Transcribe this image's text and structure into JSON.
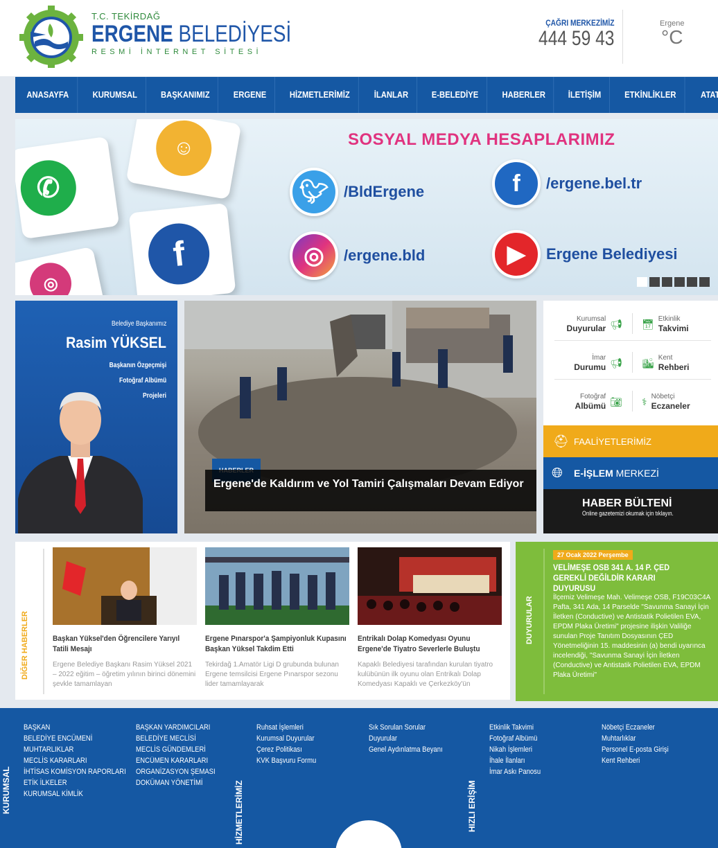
{
  "header": {
    "sub": "T.C. TEKİRDAĞ",
    "main_bold": "ERGENE",
    "main_light": "BELEDİYESİ",
    "tag": "RESMİ İNTERNET SİTESİ",
    "call_label": "ÇAĞRI MERKEZİMİZ",
    "call_number": "444 59 43",
    "weather_city": "Ergene",
    "weather_deg": "°C"
  },
  "nav": [
    "ANASAYFA",
    "KURUMSAL",
    "BAŞKANIMIZ",
    "ERGENE",
    "HİZMETLERİMİZ",
    "İLANLAR",
    "E-BELEDİYE",
    "HABERLER",
    "İLETİŞİM",
    "ETKİNLİKLER",
    "ATATÜRK EVİ"
  ],
  "banner": {
    "title": "SOSYAL MEDYA HESAPLARIMIZ",
    "twitter": "/BldErgene",
    "facebook": "/ergene.bel.tr",
    "instagram": "/ergene.bld",
    "youtube": "Ergene Belediyesi"
  },
  "mayor": {
    "role": "Belediye Başkanımız",
    "name": "Rasim YÜKSEL",
    "links": [
      "Başkanın Özgeçmişi",
      "Fotoğraf Albümü",
      "Projeleri"
    ]
  },
  "news_main": {
    "badge": "HABERLER",
    "caption": "Ergene'de Kaldırım ve Yol Tamiri Çalışmaları Devam Ediyor"
  },
  "quick": [
    {
      "top": "Kurumsal",
      "bottom": "Duyurular",
      "icon": "megaphone-icon"
    },
    {
      "top": "Etkinlik",
      "bottom": "Takvimi",
      "icon": "calendar-icon"
    },
    {
      "top": "İmar",
      "bottom": "Durumu",
      "icon": "megaphone-icon"
    },
    {
      "top": "Kent",
      "bottom": "Rehberi",
      "icon": "city-icon"
    },
    {
      "top": "Fotoğraf",
      "bottom": "Albümü",
      "icon": "camera-icon"
    },
    {
      "top": "Nöbetçi",
      "bottom": "Eczaneler",
      "icon": "pharmacy-icon"
    }
  ],
  "faaliyet": "FAALİYETLERİMİZ",
  "eislem": {
    "bold": "E-İŞLEM",
    "light": "MERKEZİ"
  },
  "bulten": {
    "title": "HABER BÜLTENİ",
    "sub": "Online gazetemizi okumak için tıklayın."
  },
  "other_news_label": "DİĞER HABERLER",
  "other_news": [
    {
      "title": "Başkan Yüksel'den Öğrencilere Yarıyıl Tatili Mesajı",
      "summary": "Ergene Belediye Başkanı Rasim Yüksel 2021 – 2022 eğitim – öğretim yılının birinci dönemini şevkle tamamlayan"
    },
    {
      "title": "Ergene Pınarspor'a Şampiyonluk Kupasını Başkan Yüksel Takdim Etti",
      "summary": "Tekirdağ 1.Amatör Ligi D grubunda bulunan Ergene temsilcisi Ergene Pınarspor sezonu lider tamamlayarak"
    },
    {
      "title": "Entrikalı Dolap Komedyası Oyunu Ergene'de Tiyatro Severlerle Buluştu",
      "summary": "Kapaklı Belediyesi tarafından kurulan tiyatro kulübünün ilk oyunu olan Entrikalı Dolap Komedyası Kapaklı ve Çerkezköy'ün"
    }
  ],
  "duyuru": {
    "label": "DUYURULAR",
    "date": "27 Ocak 2022 Perşembe",
    "title": "VELİMEŞE OSB 341 A. 14 P. ÇED GEREKLİ DEĞİLDİR KARARI DUYURUSU",
    "body": "İlçemiz Velimeşe Mah. Velimeşe OSB, F19C03C4A Pafta, 341 Ada, 14 Parselde \"Savunma Sanayi İçin İletken (Conductive) ve Antistatik Polietilen EVA, EPDM Plaka Üretimi\" projesine ilişkin Valiliğe sunulan Proje Tanıtım Dosyasının ÇED Yönetmeliğinin 15. maddesinin (a) bendi uyarınca incelendiği, \"Savunma Sanayi İçin İletken (Conductive) ve Antistatik Polietilen EVA, EPDM Plaka Üretimi\""
  },
  "footer": {
    "kurumsal_label": "KURUMSAL",
    "col1": [
      "BAŞKAN",
      "BELEDİYE ENCÜMENİ",
      "MUHTARLIKLAR",
      "MECLİS KARARLARI",
      "İHTİSAS KOMİSYON RAPORLARI",
      "ETİK İLKELER",
      "KURUMSAL KİMLİK"
    ],
    "col2": [
      "BAŞKAN YARDIMCILARI",
      "BELEDİYE MECLİSİ",
      "MECLİS GÜNDEMLERİ",
      "ENCÜMEN KARARLARI",
      "ORGANİZASYON ŞEMASI",
      "DOKÜMAN YÖNETİMİ"
    ],
    "hizmet_label": "HİZMETLERİMİZ",
    "col3": [
      "Ruhsat İşlemleri",
      "Kurumsal Duyurular",
      "Çerez Politikası",
      "KVK Başvuru Formu"
    ],
    "col4": [
      "Sık Sorulan Sorular",
      "Duyurular",
      "Genel Aydınlatma Beyanı"
    ],
    "hizli_label": "HIZLI ERİŞİM",
    "col5": [
      "Etkinlik Takvimi",
      "Fotoğraf Albümü",
      "Nikah İşlemleri",
      "İhale İlanları",
      "İmar Askı Panosu"
    ],
    "col6": [
      "Nöbetçi Eczaneler",
      "Muhtarlıklar",
      "Personel E-posta Girişi",
      "Kent Rehberi"
    ]
  }
}
